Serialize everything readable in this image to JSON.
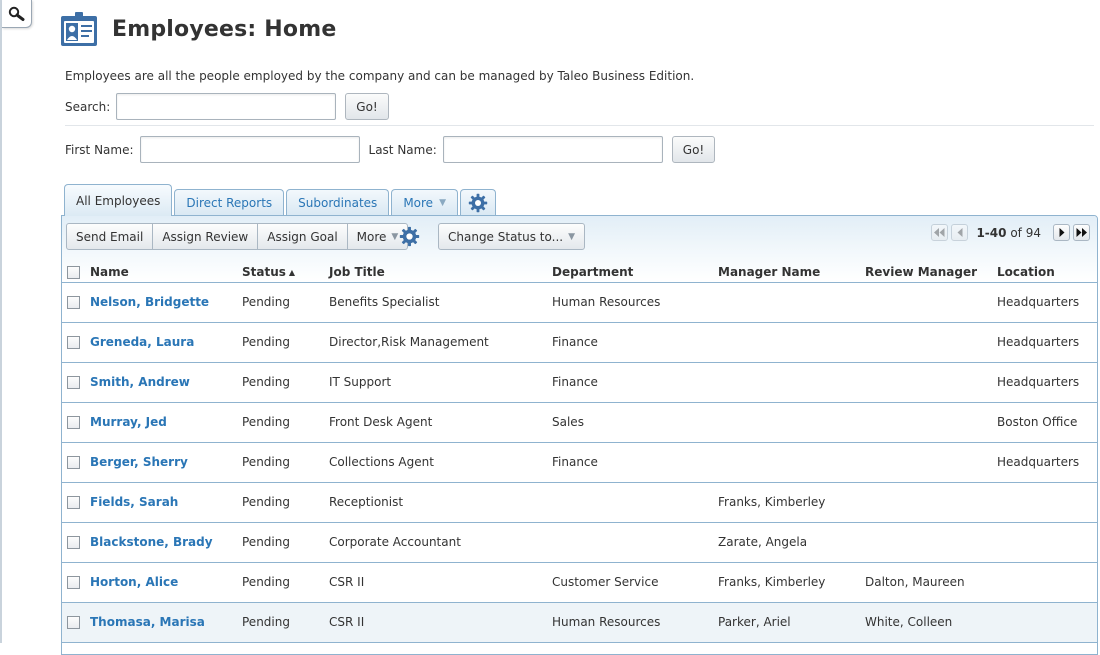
{
  "header": {
    "title": "Employees: Home"
  },
  "description": "Employees are all the people employed by the company and can be managed by Taleo Business Edition.",
  "search": {
    "label": "Search:",
    "value": "",
    "go_label": "Go!"
  },
  "name_search": {
    "first_label": "First Name:",
    "first_value": "",
    "last_label": "Last Name:",
    "last_value": "",
    "go_label": "Go!"
  },
  "tabs": [
    {
      "label": "All Employees",
      "active": true
    },
    {
      "label": "Direct Reports"
    },
    {
      "label": "Subordinates"
    },
    {
      "label": "More"
    }
  ],
  "toolbar": {
    "send_email": "Send Email",
    "assign_review": "Assign Review",
    "assign_goal": "Assign Goal",
    "more": "More",
    "change_status": "Change Status to..."
  },
  "pager": {
    "range": "1-40",
    "of": "of",
    "total": "94"
  },
  "table": {
    "columns": [
      "Name",
      "Status",
      "Job Title",
      "Department",
      "Manager Name",
      "Review Manager",
      "Location"
    ],
    "rows": [
      {
        "name": "Nelson, Bridgette",
        "status": "Pending",
        "job": "Benefits Specialist",
        "dept": "Human Resources",
        "manager": "",
        "review": "",
        "location": "Headquarters"
      },
      {
        "name": "Greneda, Laura",
        "status": "Pending",
        "job": "Director,Risk Management",
        "dept": "Finance",
        "manager": "",
        "review": "",
        "location": "Headquarters"
      },
      {
        "name": "Smith, Andrew",
        "status": "Pending",
        "job": "IT Support",
        "dept": "Finance",
        "manager": "",
        "review": "",
        "location": "Headquarters"
      },
      {
        "name": "Murray, Jed",
        "status": "Pending",
        "job": "Front Desk Agent",
        "dept": "Sales",
        "manager": "",
        "review": "",
        "location": "Boston Office"
      },
      {
        "name": "Berger, Sherry",
        "status": "Pending",
        "job": "Collections Agent",
        "dept": "Finance",
        "manager": "",
        "review": "",
        "location": "Headquarters"
      },
      {
        "name": "Fields, Sarah",
        "status": "Pending",
        "job": "Receptionist",
        "dept": "",
        "manager": "Franks, Kimberley",
        "review": "",
        "location": ""
      },
      {
        "name": "Blackstone, Brady",
        "status": "Pending",
        "job": "Corporate Accountant",
        "dept": "",
        "manager": "Zarate, Angela",
        "review": "",
        "location": ""
      },
      {
        "name": "Horton, Alice",
        "status": "Pending",
        "job": "CSR II",
        "dept": "Customer Service",
        "manager": "Franks, Kimberley",
        "review": "Dalton, Maureen",
        "location": ""
      },
      {
        "name": "Thomasa, Marisa",
        "status": "Pending",
        "job": "CSR II",
        "dept": "Human Resources",
        "manager": "Parker, Ariel",
        "review": "White, Colleen",
        "location": ""
      }
    ]
  },
  "colors": {
    "link": "#2a76b6",
    "border": "#8fb3cf",
    "title": "#333333"
  },
  "icons": {
    "toggle": "magnifier-icon",
    "header": "employee-badge-icon",
    "settings": "gear-icon"
  }
}
